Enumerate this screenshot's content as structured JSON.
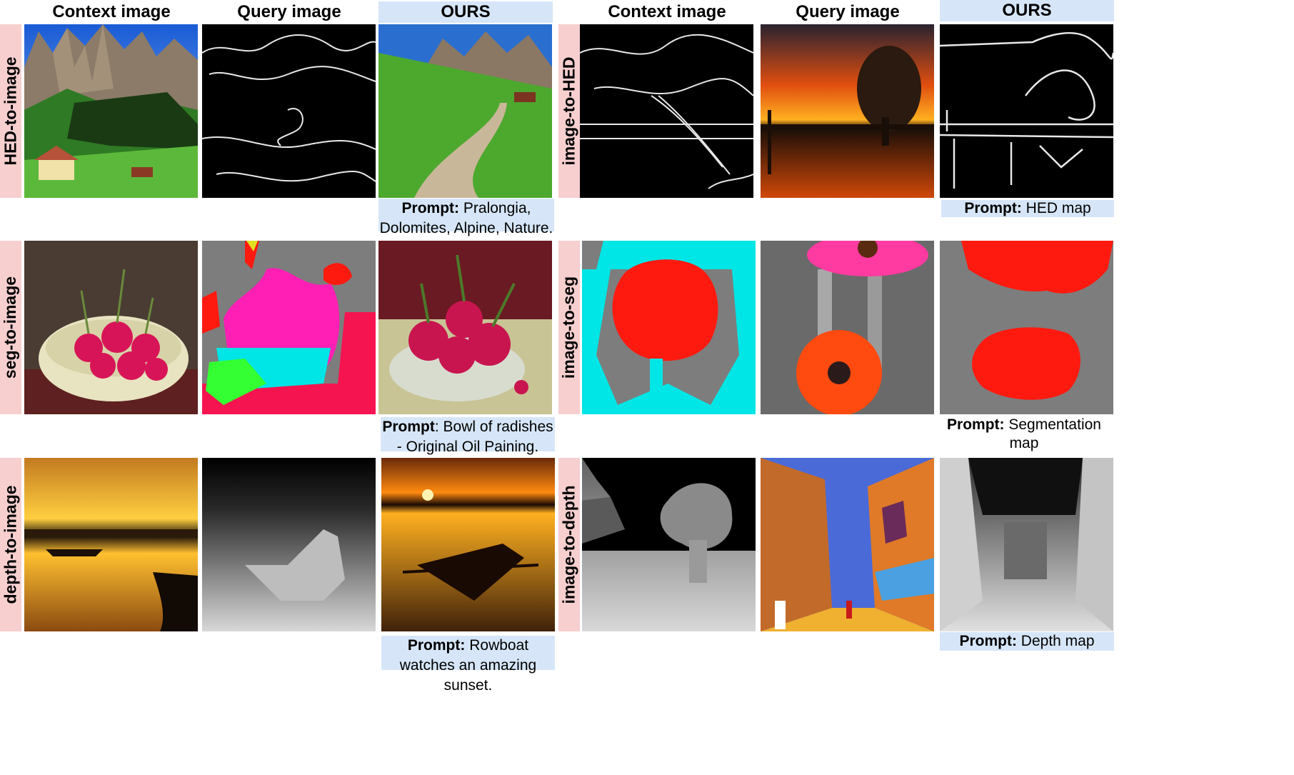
{
  "headers": {
    "context": "Context image",
    "query": "Query image",
    "ours": "OURS"
  },
  "rows_left": [
    {
      "task": "HED-to-image",
      "prompt_label": "Prompt:",
      "prompt_text": "Pralongia, Dolomites, Alpine, Nature."
    },
    {
      "task": "seg-to-image",
      "prompt_label": "Prompt",
      "prompt_text": ": Bowl of radishes - Original Oil Paining."
    },
    {
      "task": "depth-to-image",
      "prompt_label": "Prompt:",
      "prompt_text": "Rowboat watches an amazing sunset."
    }
  ],
  "rows_right": [
    {
      "task": "image-to-HED",
      "prompt_label": "Prompt:",
      "prompt_text": "HED map"
    },
    {
      "task": "image-to-seg",
      "prompt_label": "Prompt:",
      "prompt_text": "Segmentation map"
    },
    {
      "task": "image-to-depth",
      "prompt_label": "Prompt:",
      "prompt_text": "Depth map"
    }
  ],
  "colors": {
    "ours_header_bg": "#d6e6f8",
    "task_label_bg": "#f7cfcf",
    "seg_gray": "#7d7d7d",
    "seg_red": "#ff1a10",
    "seg_cyan": "#00e5e5",
    "seg_magenta": "#ff1fb4",
    "seg_green": "#33ff33",
    "seg_crimson": "#f51450"
  },
  "images": [
    "context-alpine-meadow",
    "query-hed-edges-meadow",
    "ours-alpine-path",
    "context-hed-edges-lake",
    "query-sunset-lake-tree",
    "ours-hed-map",
    "context-radish-painting",
    "query-seg-radish",
    "ours-radish-bowl",
    "context-seg-flower",
    "query-gerbera-flowers",
    "ours-seg-map",
    "context-sunset-rowboat",
    "query-depth-rowboat",
    "ours-rowboat-sunset",
    "context-depth-tree",
    "query-street-painting",
    "ours-depth-map"
  ]
}
